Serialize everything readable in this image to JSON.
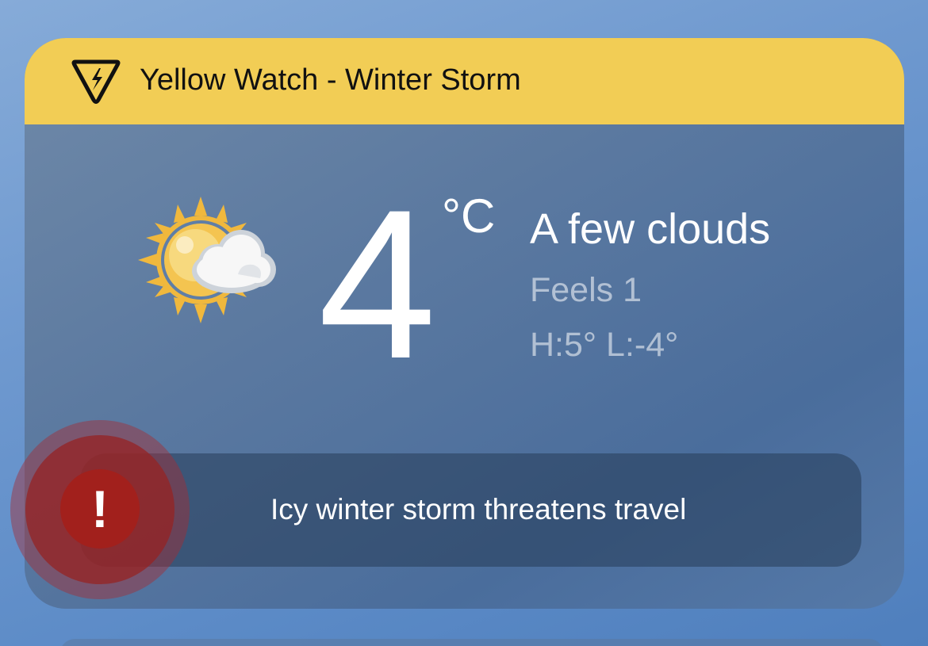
{
  "alert": {
    "title": "Yellow Watch - Winter Storm",
    "level_color": "#f2cd55",
    "icon": "storm-warning-icon"
  },
  "current": {
    "temperature": "4",
    "unit": "°C",
    "condition": "A few clouds",
    "feels_like": "Feels 1",
    "high_low": "H:5° L:-4°",
    "icon": "partly-cloudy-icon"
  },
  "news": {
    "headline": "Icy winter storm threatens travel",
    "badge_symbol": "!",
    "badge_icon": "exclamation-icon"
  }
}
